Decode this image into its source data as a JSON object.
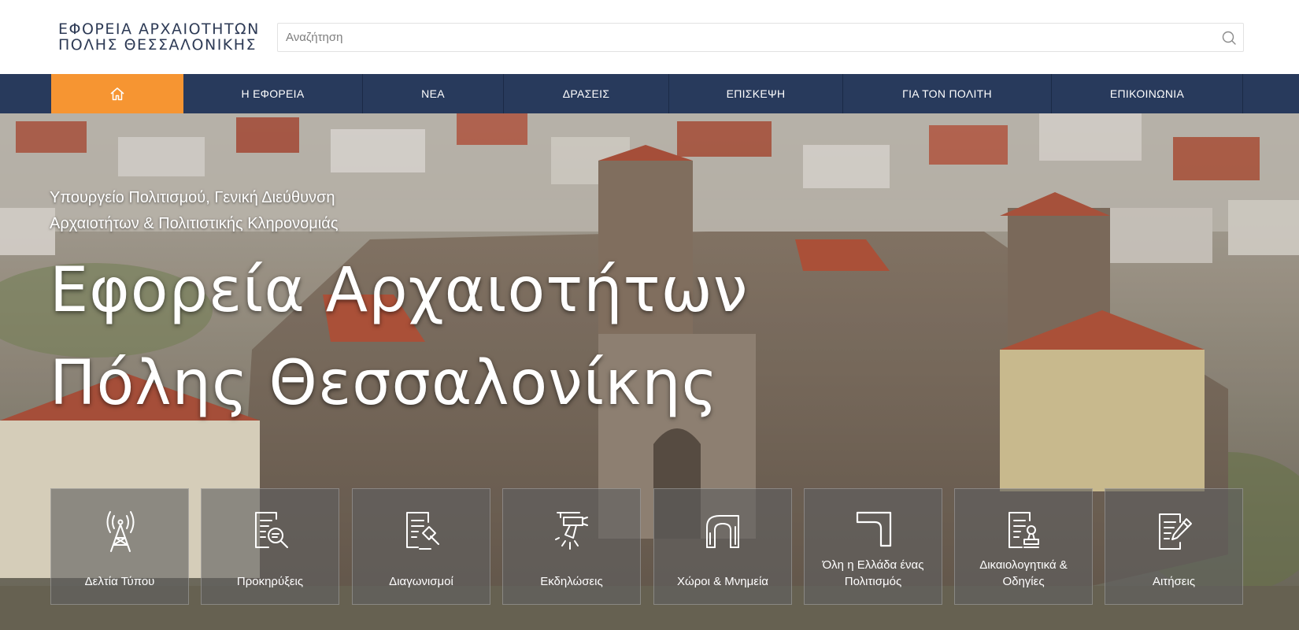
{
  "header": {
    "logo_line1": "ΕΦΟΡΕΙΑ ΑΡΧΑΙΟΤΗΤΩΝ",
    "logo_line2": "ΠΟΛΗΣ ΘΕΣΣΑΛΟΝΙΚΗΣ",
    "search_placeholder": "Αναζήτηση",
    "search_icon": "search-icon"
  },
  "nav": {
    "home_icon": "home-icon",
    "items": [
      {
        "label": "Η ΕΦΟΡΕΙΑ"
      },
      {
        "label": "ΝΕΑ"
      },
      {
        "label": "ΔΡΑΣΕΙΣ"
      },
      {
        "label": "ΕΠΙΣΚΕΨΗ"
      },
      {
        "label": "ΓΙΑ ΤΟΝ ΠΟΛΙΤΗ"
      },
      {
        "label": "ΕΠΙΚΟΙΝΩΝΙΑ"
      }
    ]
  },
  "hero": {
    "subtitle_line1": "Υπουργείο Πολιτισμού, Γενική Διεύθυνση",
    "subtitle_line2": "Αρχαιοτήτων & Πολιτιστικής Κληρονομιάς",
    "title_line1": "Εφορεία Αρχαιοτήτων",
    "title_line2": "Πόλης Θεσσαλονίκης"
  },
  "cards": [
    {
      "label": "Δελτία Τύπου",
      "icon": "broadcast-tower-icon"
    },
    {
      "label": "Προκηρύξεις",
      "icon": "document-search-icon"
    },
    {
      "label": "Διαγωνισμοί",
      "icon": "document-gavel-icon"
    },
    {
      "label": "Εκδηλώσεις",
      "icon": "spotlight-icon"
    },
    {
      "label": "Χώροι & Μνημεία",
      "icon": "arch-monument-icon"
    },
    {
      "label": "Όλη η Ελλάδα ένας Πολιτισμός",
      "icon": "corner-frame-icon"
    },
    {
      "label": "Δικαιολογητικά & Οδηγίες",
      "icon": "document-stamp-icon"
    },
    {
      "label": "Αιτήσεις",
      "icon": "document-pen-icon"
    }
  ],
  "colors": {
    "nav_background": "#283a5c",
    "nav_home_accent": "#f69532",
    "logo_text": "#2d3a55"
  }
}
